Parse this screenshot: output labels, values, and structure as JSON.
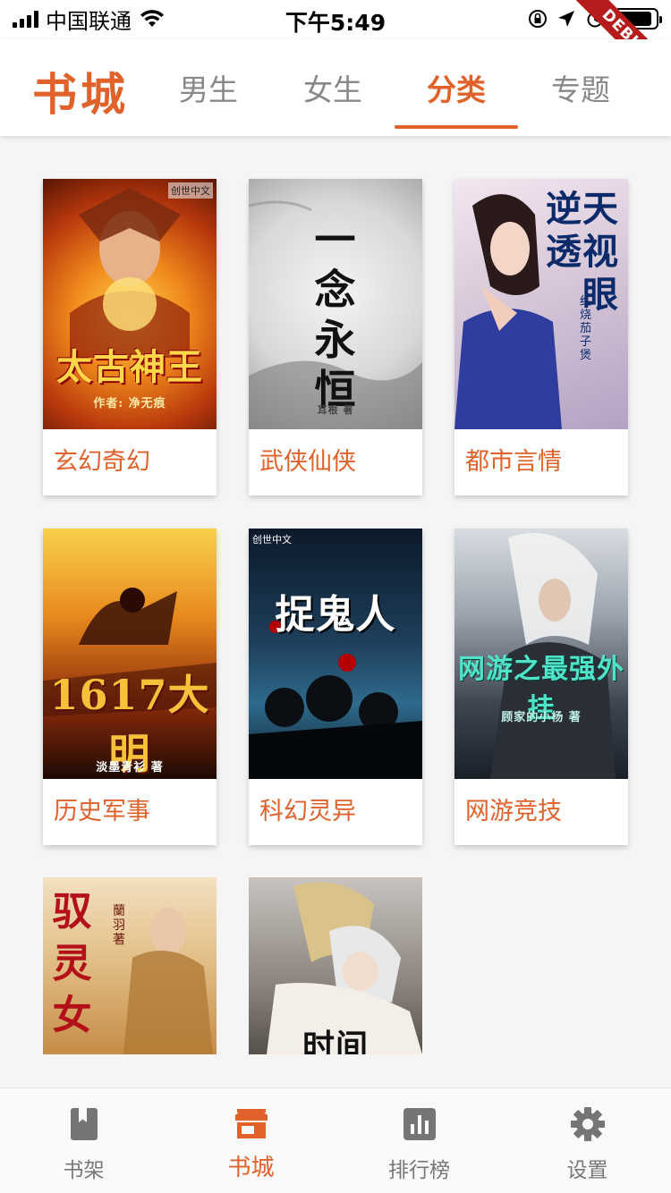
{
  "status_bar": {
    "carrier": "中国联通",
    "time": "下午5:49"
  },
  "debug_banner": "DEBUG",
  "header": {
    "app_title": "书城",
    "tabs": [
      {
        "label": "男生",
        "active": false
      },
      {
        "label": "女生",
        "active": false
      },
      {
        "label": "分类",
        "active": true
      },
      {
        "label": "专题",
        "active": false
      }
    ]
  },
  "categories": [
    {
      "label": "玄幻奇幻",
      "cover_text": "太古神王",
      "cover_author": "作者: 净无痕",
      "cover_badge": "创世中文"
    },
    {
      "label": "武侠仙侠",
      "cover_text": "一念永恒",
      "cover_author": "耳根 著",
      "cover_badge": ""
    },
    {
      "label": "都市言情",
      "cover_text": "逆天透视眼",
      "cover_author": "红烧茄子煲",
      "cover_badge": ""
    },
    {
      "label": "历史军事",
      "cover_text": "1617大明",
      "cover_author": "淡墨青衫 著",
      "cover_badge": ""
    },
    {
      "label": "科幻灵异",
      "cover_text": "捉鬼人",
      "cover_author": "",
      "cover_badge": "创世中文"
    },
    {
      "label": "网游竞技",
      "cover_text": "网游之最强外挂",
      "cover_author": "顾家的小杨 著",
      "cover_badge": ""
    },
    {
      "label": "",
      "cover_text": "驭灵女",
      "cover_author": "蘭羽 著",
      "cover_badge": ""
    },
    {
      "label": "",
      "cover_text": "时间",
      "cover_author": "",
      "cover_badge": ""
    }
  ],
  "bottom_nav": [
    {
      "label": "书架",
      "icon": "bookmark-book-icon",
      "active": false
    },
    {
      "label": "书城",
      "icon": "store-icon",
      "active": true
    },
    {
      "label": "排行榜",
      "icon": "bar-chart-icon",
      "active": false
    },
    {
      "label": "设置",
      "icon": "gear-icon",
      "active": false
    }
  ],
  "colors": {
    "accent": "#e0622a",
    "inactive": "#777777",
    "debug": "#b71c1c"
  }
}
